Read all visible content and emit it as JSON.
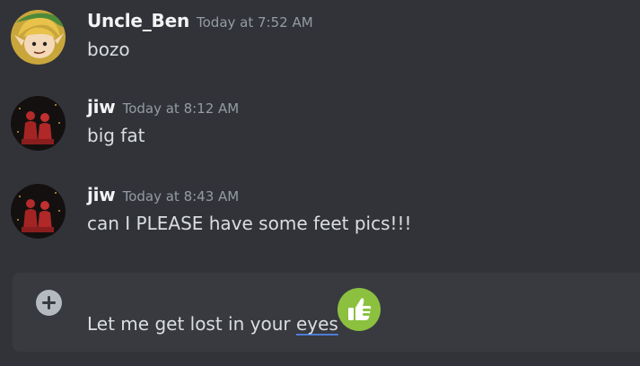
{
  "messages": [
    {
      "author": "Uncle_Ben",
      "timestamp": "Today at 7:52 AM",
      "content": "bozo",
      "avatar_icon": "link-character-avatar"
    },
    {
      "author": "jiw",
      "timestamp": "Today at 8:12 AM",
      "content": "big fat",
      "avatar_icon": "red-figures-avatar"
    },
    {
      "author": "jiw",
      "timestamp": "Today at 8:43 AM",
      "content": "can I PLEASE have some feet pics!!!",
      "avatar_icon": "red-figures-avatar"
    }
  ],
  "composer": {
    "text_before": "Let me get lost in your ",
    "misspelled_word": "eyes",
    "attach_icon": "plus-circle-icon",
    "emoji_icon": "thumbs-up-emoji-icon"
  },
  "colors": {
    "background": "#313338",
    "composer_background": "#383a40",
    "author": "#f2f3f5",
    "timestamp": "#949ba4",
    "text": "#dbdee1",
    "spellcheck_underline": "#4e7bd6",
    "emoji_green": "#8bc13f"
  }
}
